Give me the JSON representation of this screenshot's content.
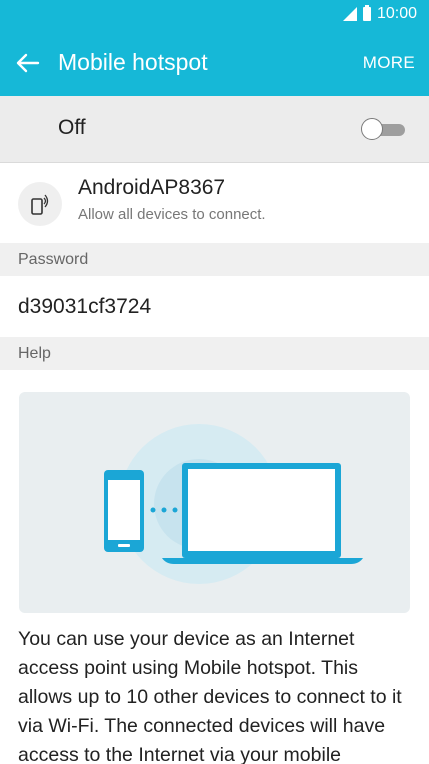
{
  "status_bar": {
    "time": "10:00"
  },
  "header": {
    "title": "Mobile hotspot",
    "more_label": "MORE"
  },
  "toggle": {
    "label": "Off",
    "state": "off"
  },
  "network": {
    "name": "AndroidAP8367",
    "subtitle": "Allow all devices to connect."
  },
  "password_section": {
    "header": "Password",
    "value": "d39031cf3724"
  },
  "help_section": {
    "header": "Help",
    "text": "You can use your device as an Internet access point using Mobile hotspot. This allows up to 10 other devices to connect to it via Wi-Fi. The connected devices will have access to the Internet via your mobile"
  },
  "colors": {
    "accent": "#16b8d7",
    "illustration_bg": "#e9eef0",
    "device_blue": "#1ba6d6"
  }
}
